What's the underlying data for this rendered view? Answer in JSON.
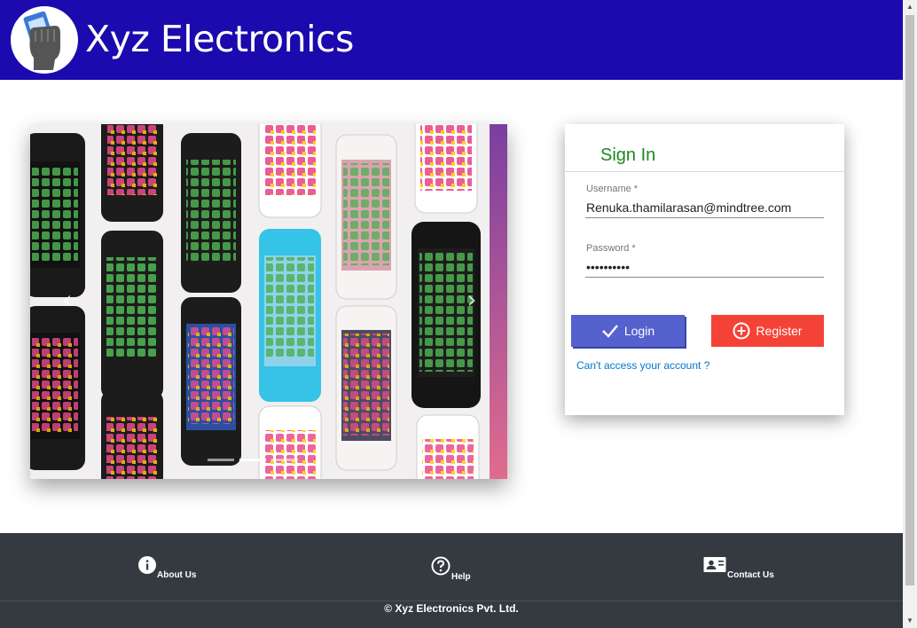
{
  "header": {
    "brand_name": "Xyz Electronics",
    "logo_icon": "hand-holding-phone-logo",
    "bg_color": "#1b0aae"
  },
  "carousel": {
    "image_icon": "iphone-collage-image",
    "prev_glyph": "‹",
    "next_glyph": "›",
    "slide_count": 3,
    "active_slide": 2
  },
  "signin": {
    "title": "Sign In",
    "username_label": "Username *",
    "username_value": "Renuka.thamilarasan@mindtree.com",
    "password_label": "Password *",
    "password_value": "••••••••••",
    "login_label": "Login",
    "register_label": "Register",
    "forgot_link": "Can't access your account ?",
    "title_color": "#1b8a1b",
    "login_color": "#5561cc",
    "register_color": "#f44336"
  },
  "footer": {
    "about_label": "About Us",
    "help_label": "Help",
    "contact_label": "Contact Us",
    "copyright": "© Xyz Electronics Pvt. Ltd.",
    "bg_color": "#343a40"
  }
}
